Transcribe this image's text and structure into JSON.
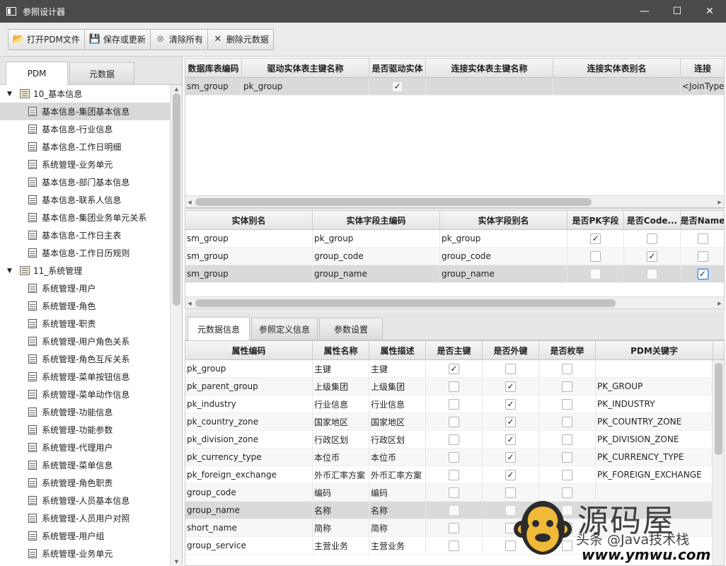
{
  "window": {
    "title": "参照设计器",
    "controls": [
      "minimize",
      "maximize",
      "close"
    ]
  },
  "toolbar": {
    "buttons": [
      {
        "label": "打开PDM文件",
        "icon": "folder-open-icon"
      },
      {
        "label": "保存或更新",
        "icon": "save-icon"
      },
      {
        "label": "清除所有",
        "icon": "clear-icon"
      },
      {
        "label": "删除元数据",
        "icon": "delete-icon"
      }
    ]
  },
  "left_tabs": [
    "PDM",
    "元数据"
  ],
  "tree": {
    "groups": [
      {
        "label": "10_基本信息",
        "items": [
          "基本信息-集团基本信息",
          "基本信息-行业信息",
          "基本信息-工作日明细",
          "系统管理-业务单元",
          "基本信息-部门基本信息",
          "基本信息-联系人信息",
          "基本信息-集团业务单元关系",
          "基本信息-工作日主表",
          "基本信息-工作日历规则"
        ]
      },
      {
        "label": "11_系统管理",
        "items": [
          "系统管理-用户",
          "系统管理-角色",
          "系统管理-职责",
          "系统管理-用户角色关系",
          "系统管理-角色互斥关系",
          "系统管理-菜单按钮信息",
          "系统管理-菜单动作信息",
          "系统管理-功能信息",
          "系统管理-功能参数",
          "系统管理-代理用户",
          "系统管理-菜单信息",
          "系统管理-角色职责",
          "系统管理-人员基本信息",
          "系统管理-人员用户对照",
          "系统管理-用户组",
          "系统管理-业务单元"
        ]
      }
    ],
    "selected": "基本信息-集团基本信息"
  },
  "join_table": {
    "headers": [
      "数据库表编码",
      "驱动实体表主键名称",
      "是否驱动实体",
      "连接实体表主键名称",
      "连接实体表别名",
      "连接"
    ],
    "rows": [
      {
        "cells": [
          "sm_group",
          "pk_group",
          "✓",
          "",
          "",
          "<JoinType"
        ]
      }
    ]
  },
  "field_table": {
    "headers": [
      "实体别名",
      "实体字段主编码",
      "实体字段别名",
      "是否PK字段",
      "是否Code...",
      "是否Name"
    ],
    "rows": [
      {
        "alias": "sm_group",
        "code": "pk_group",
        "falias": "pk_group",
        "pk": true,
        "isCode": false,
        "isName": false
      },
      {
        "alias": "sm_group",
        "code": "group_code",
        "falias": "group_code",
        "pk": false,
        "isCode": true,
        "isName": false
      },
      {
        "alias": "sm_group",
        "code": "group_name",
        "falias": "group_name",
        "pk": false,
        "isCode": false,
        "isName": true
      }
    ]
  },
  "bottom_tabs": [
    "元数据信息",
    "参照定义信息",
    "参数设置"
  ],
  "meta_table": {
    "headers": [
      "属性编码",
      "属性名称",
      "属性描述",
      "是否主键",
      "是否外键",
      "是否枚举",
      "PDM关键字"
    ],
    "rows": [
      {
        "code": "pk_group",
        "name": "主键",
        "desc": "主键",
        "pk": true,
        "fk": false,
        "en": false,
        "kw": ""
      },
      {
        "code": "pk_parent_group",
        "name": "上级集团",
        "desc": "上级集团",
        "pk": false,
        "fk": true,
        "en": false,
        "kw": "PK_GROUP"
      },
      {
        "code": "pk_industry",
        "name": "行业信息",
        "desc": "行业信息",
        "pk": false,
        "fk": true,
        "en": false,
        "kw": "PK_INDUSTRY"
      },
      {
        "code": "pk_country_zone",
        "name": "国家地区",
        "desc": "国家地区",
        "pk": false,
        "fk": true,
        "en": false,
        "kw": "PK_COUNTRY_ZONE"
      },
      {
        "code": "pk_division_zone",
        "name": "行政区划",
        "desc": "行政区划",
        "pk": false,
        "fk": true,
        "en": false,
        "kw": "PK_DIVISION_ZONE"
      },
      {
        "code": "pk_currency_type",
        "name": "本位币",
        "desc": "本位币",
        "pk": false,
        "fk": true,
        "en": false,
        "kw": "PK_CURRENCY_TYPE"
      },
      {
        "code": "pk_foreign_exchange",
        "name": "外币汇率方案",
        "desc": "外币汇率方案",
        "pk": false,
        "fk": true,
        "en": false,
        "kw": "PK_FOREIGN_EXCHANGE"
      },
      {
        "code": "group_code",
        "name": "编码",
        "desc": "编码",
        "pk": false,
        "fk": false,
        "en": false,
        "kw": ""
      },
      {
        "code": "group_name",
        "name": "名称",
        "desc": "名称",
        "pk": false,
        "fk": false,
        "en": false,
        "kw": ""
      },
      {
        "code": "short_name",
        "name": "简称",
        "desc": "简称",
        "pk": false,
        "fk": false,
        "en": false,
        "kw": ""
      },
      {
        "code": "group_service",
        "name": "主营业务",
        "desc": "主营业务",
        "pk": false,
        "fk": false,
        "en": false,
        "kw": ""
      }
    ],
    "selected_index": 8
  },
  "watermark": {
    "brand": "源码屋",
    "sub": "头条 @Java技术栈",
    "url": "www.ymwu.com"
  },
  "colors": {
    "titlebar": "#4a4a4a",
    "selection": "#d9d9d9",
    "focus": "#3b7fd1"
  }
}
